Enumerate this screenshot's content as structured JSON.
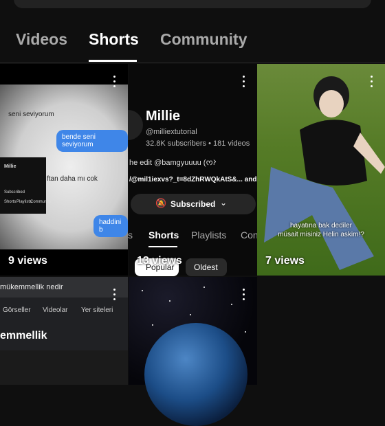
{
  "tabs": [
    {
      "label": "Videos",
      "active": false
    },
    {
      "label": "Shorts",
      "active": true
    },
    {
      "label": "Community",
      "active": false
    }
  ],
  "shorts": [
    {
      "views": "9 views",
      "chat": {
        "line1": "seni seviyorum",
        "line2": "bende seni seviyorum",
        "line3": "ftan daha mı cok",
        "line4": "haddini b",
        "mini_name": "Millie",
        "mini_subscribe": "Subscribed",
        "mini_tabs": [
          "Shorts",
          "Playlists",
          "Community"
        ]
      }
    },
    {
      "views": "13 views",
      "channel": {
        "name": "Millie",
        "handle": "@milliextutorial",
        "stats": "32.8K subscribers • 181 videos",
        "edit": "he edit @bamgyuuuu (ᰔ.",
        "link": "/@mil1iexvs?_t=8dZhRWQkAtS&... and 1",
        "subscribe_label": "Subscribed",
        "tabs": [
          "s",
          "Shorts",
          "Playlists",
          "Con"
        ],
        "chips": [
          "Popular",
          "Oldest"
        ]
      }
    },
    {
      "views": "7 views",
      "caption_line1": "hayatına bak dediler",
      "caption_line2": "müsait misiniz Helin askim!?"
    },
    {
      "search": {
        "query": "mükemmellik nedir",
        "filters": [
          "Görseller",
          "Videolar",
          "Yer siteleri"
        ],
        "result": "emmellik"
      }
    },
    {
      "scene": "earth-from-space"
    }
  ],
  "colors": {
    "background": "#0f0f0f",
    "bubble_blue": "#3f86e8"
  }
}
